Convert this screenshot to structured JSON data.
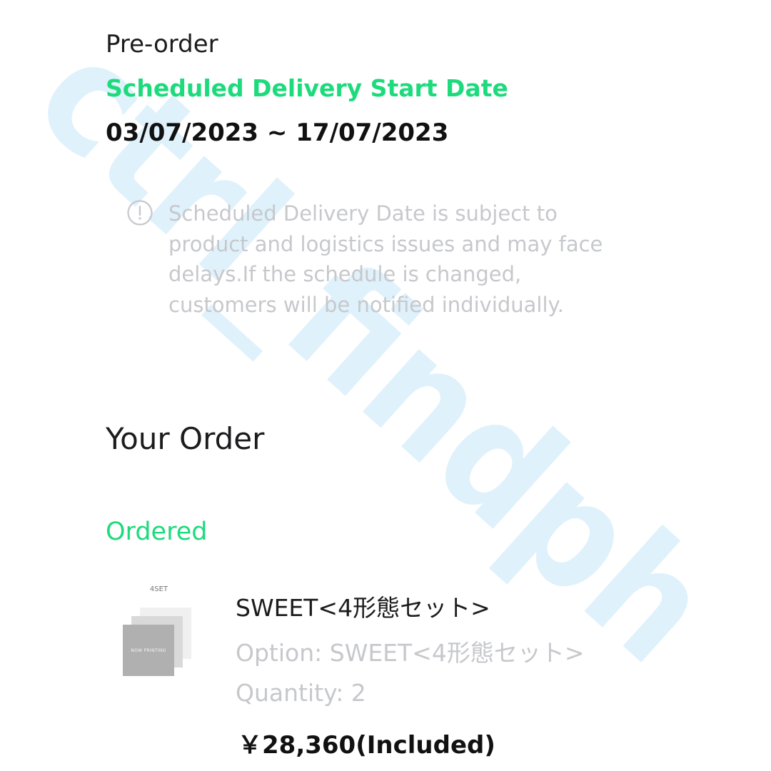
{
  "preorder": {
    "label": "Pre-order",
    "delivery_title": "Scheduled Delivery Start Date",
    "delivery_range": "03/07/2023 ~ 17/07/2023"
  },
  "notice": {
    "icon": "info-circle-icon",
    "text": "Scheduled Delivery Date is subject to product and logistics issues and may face delays.If the schedule is changed, customers will be notified individually."
  },
  "order": {
    "heading": "Your Order",
    "status": "Ordered",
    "item": {
      "thumb_label": "4SET",
      "thumb_cover_text": "NOW PRINTING",
      "name": "SWEET<4形態セット>",
      "option": "Option: SWEET<4形態セット>",
      "quantity": "Quantity: 2",
      "price": "￥28,360(Included)"
    }
  },
  "watermark": {
    "text": "ctrl_findph"
  },
  "colors": {
    "accent_green": "#1ddb7c",
    "muted_text": "#c7c8cc",
    "watermark": "#dff1fb"
  }
}
